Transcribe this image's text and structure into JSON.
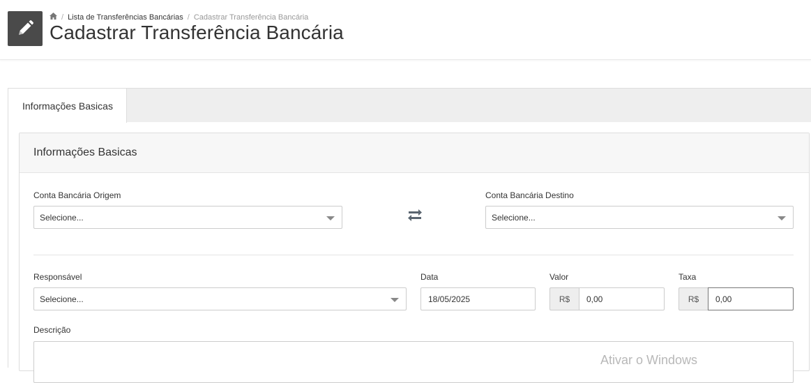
{
  "header": {
    "icon": "pencil-icon",
    "breadcrumb": {
      "home_icon": "home-icon",
      "separator": "/",
      "parent": "Lista de Transferências Bancárias",
      "current": "Cadastrar Transferência Bancária"
    },
    "title": "Cadastrar Transferência Bancária"
  },
  "tabs": [
    {
      "label": "Informações Basicas",
      "active": true
    }
  ],
  "panel": {
    "heading": "Informações Basicas",
    "origin_account": {
      "label": "Conta Bancária Origem",
      "value": "Selecione..."
    },
    "swap_icon": "swap-arrows-icon",
    "destination_account": {
      "label": "Conta Bancária Destino",
      "value": "Selecione..."
    },
    "responsible": {
      "label": "Responsável",
      "value": "Selecione..."
    },
    "date": {
      "label": "Data",
      "value": "18/05/2025"
    },
    "amount": {
      "label": "Valor",
      "prefix": "R$",
      "value": "0,00"
    },
    "fee": {
      "label": "Taxa",
      "prefix": "R$",
      "value": "0,00"
    },
    "description": {
      "label": "Descrição",
      "value": ""
    }
  },
  "watermark": "Ativar o Windows",
  "colors": {
    "header_icon_bg": "#4a4a4a",
    "tab_bar_bg": "#eeeeee",
    "panel_heading_bg": "#f7f7f7"
  }
}
